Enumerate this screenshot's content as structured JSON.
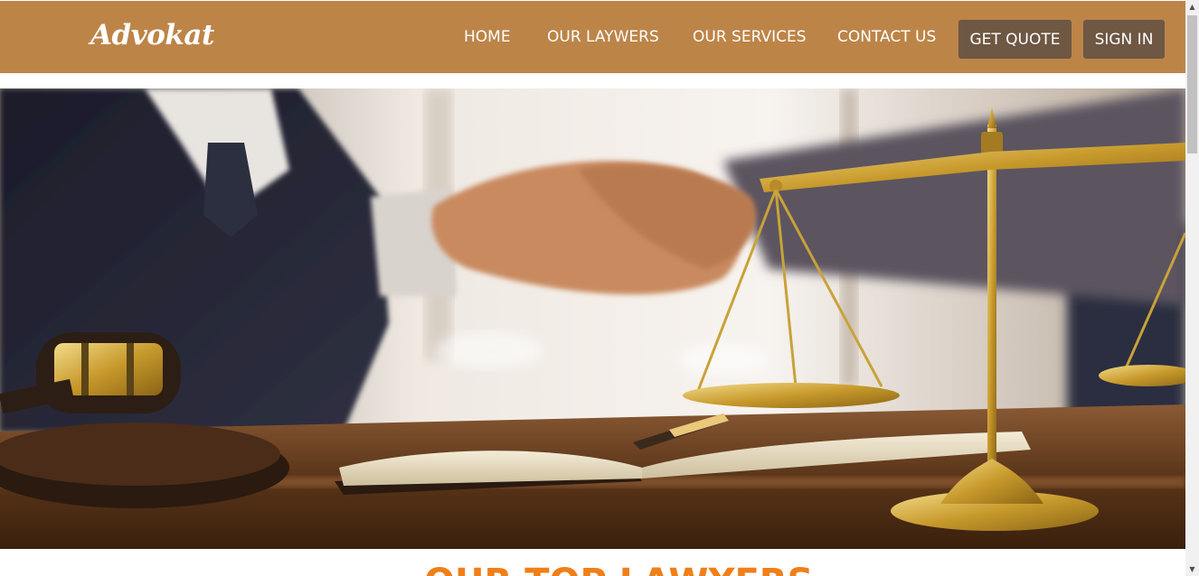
{
  "brand": {
    "logo_text": "Advokat"
  },
  "nav": {
    "links": [
      "HOME",
      "OUR LAYWERS",
      "OUR SERVICES",
      "CONTACT US"
    ],
    "get_quote_label": "GET QUOTE",
    "sign_in_label": "SIGN IN"
  },
  "hero": {
    "image_description": "hero-photo-handshake-gavel-scales"
  },
  "section": {
    "heading": "OUR TOP LAWYERS"
  },
  "colors": {
    "header_bg": "#bd8448",
    "button_bg": "#6e5743",
    "heading_orange": "#ef7f1a"
  }
}
